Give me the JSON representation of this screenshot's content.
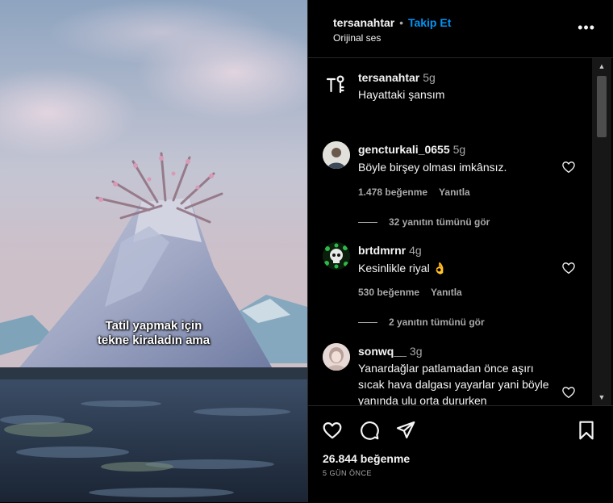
{
  "header": {
    "username": "tersanahtar",
    "separator": "•",
    "follow_label": "Takip Et",
    "audio_label": "Orijinal ses",
    "more_label": "•••"
  },
  "video": {
    "caption_line1": "Tatil yapmak için",
    "caption_line2": "tekne kiraladın ama"
  },
  "post_caption": {
    "username": "tersanahtar",
    "time": "5g",
    "text": "Hayattaki şansım"
  },
  "comments": [
    {
      "username": "gencturkali_0655",
      "time": "5g",
      "text": "Böyle birşey olması imkânsız.",
      "likes": "1.478 beğenme",
      "reply_label": "Yanıtla",
      "view_replies": "32 yanıtın tümünü gör"
    },
    {
      "username": "brtdmrnr",
      "time": "4g",
      "text": "Kesinlikle riyal 👌",
      "likes": "530 beğenme",
      "reply_label": "Yanıtla",
      "view_replies": "2 yanıtın tümünü gör"
    },
    {
      "username": "sonwq__",
      "time": "3g",
      "text": "Yanardağlar patlamadan önce aşırı sıcak hava dalgası yayarlar yani böyle yanında ulu orta dururken"
    }
  ],
  "footer": {
    "likes": "26.844 beğenme",
    "date": "5 GÜN ÖNCE"
  },
  "colors": {
    "background": "#000000",
    "accent_blue": "#0095f6",
    "secondary_text": "#a8a8a8",
    "divider": "#262626"
  },
  "icons": [
    "more-icon",
    "heart-icon",
    "comment-icon",
    "share-icon",
    "bookmark-icon",
    "scroll-up-icon",
    "scroll-down-icon"
  ]
}
